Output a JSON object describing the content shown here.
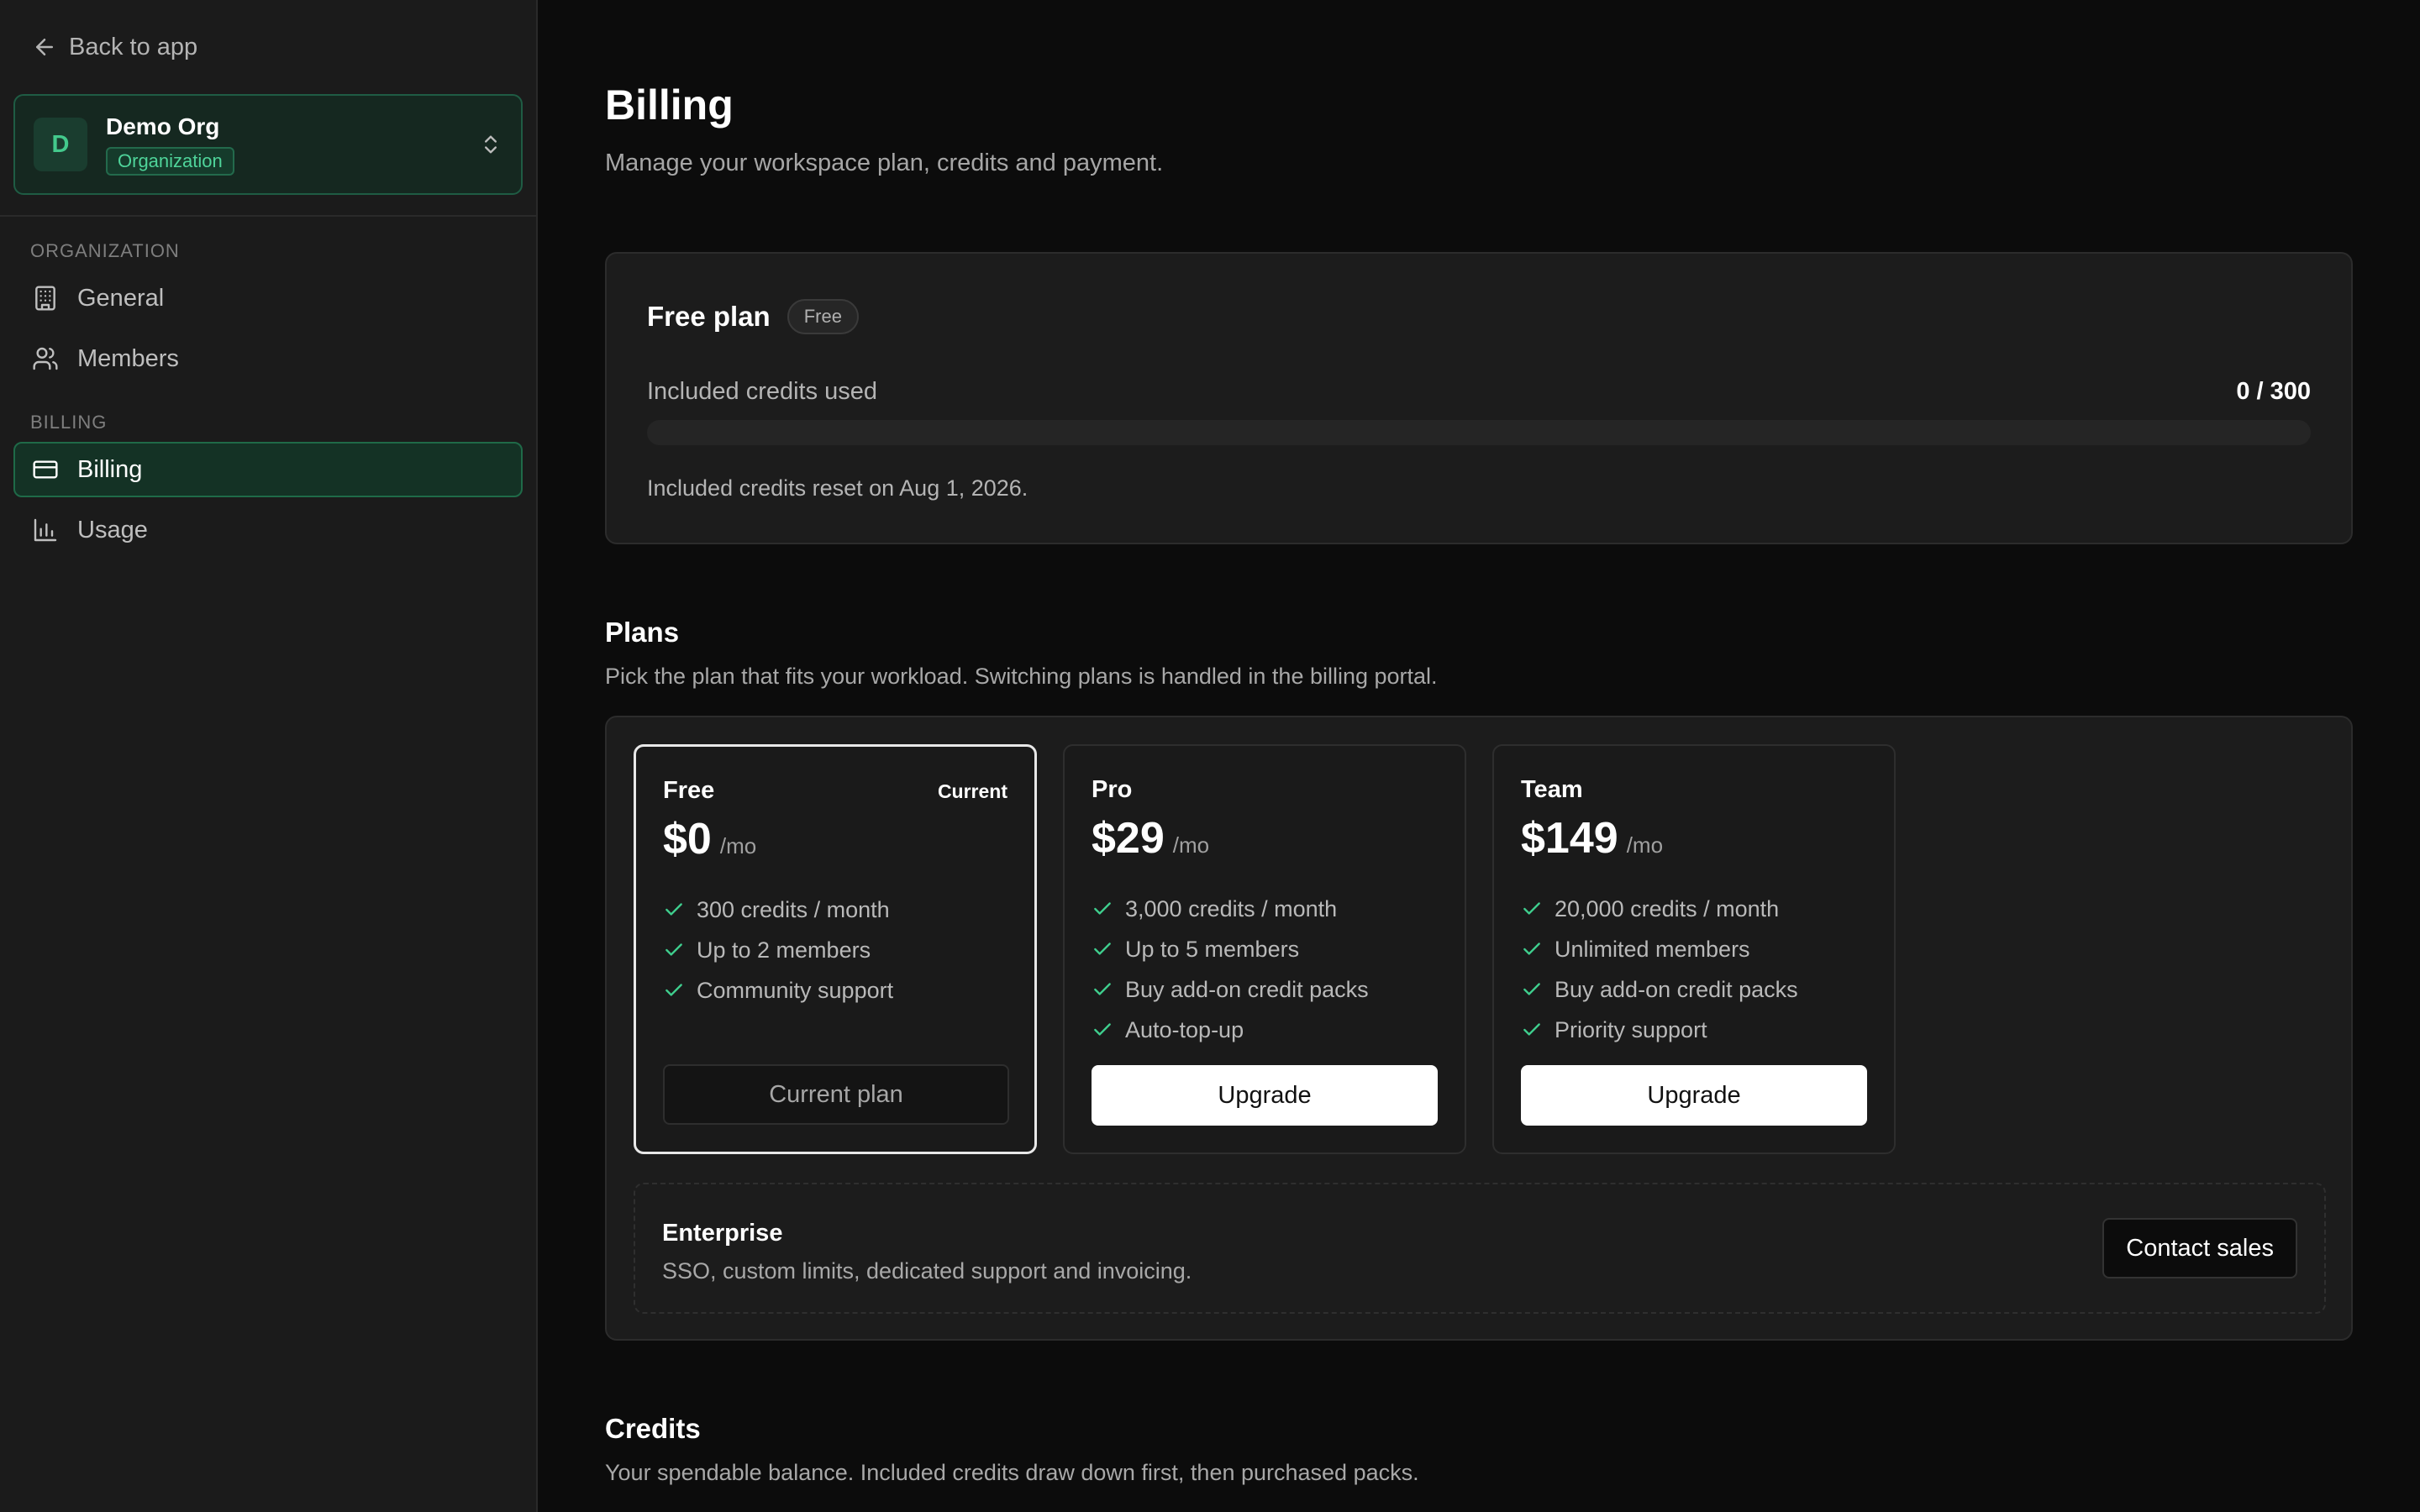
{
  "sidebar": {
    "back_label": "Back to app",
    "org": {
      "initial": "D",
      "name": "Demo Org",
      "badge": "Organization"
    },
    "sections": [
      {
        "label": "ORGANIZATION",
        "items": [
          {
            "label": "General",
            "icon": "building-icon"
          },
          {
            "label": "Members",
            "icon": "users-icon"
          }
        ]
      },
      {
        "label": "BILLING",
        "items": [
          {
            "label": "Billing",
            "icon": "credit-card-icon",
            "active": true
          },
          {
            "label": "Usage",
            "icon": "bar-chart-icon"
          }
        ]
      }
    ]
  },
  "header": {
    "title": "Billing",
    "subtitle": "Manage your workspace plan, credits and payment."
  },
  "current_plan": {
    "title": "Free plan",
    "badge": "Free",
    "usage_label": "Included credits used",
    "usage_value": "0 / 300",
    "used_fraction": 0,
    "reset_text": "Included credits reset on Aug 1, 2026."
  },
  "plans": {
    "title": "Plans",
    "subtitle": "Pick the plan that fits your workload. Switching plans is handled in the billing portal.",
    "tiers": [
      {
        "name": "Free",
        "current_label": "Current",
        "price": "$0",
        "unit": "/mo",
        "features": [
          "300 credits / month",
          "Up to 2 members",
          "Community support"
        ],
        "button": "Current plan"
      },
      {
        "name": "Pro",
        "price": "$29",
        "unit": "/mo",
        "features": [
          "3,000 credits / month",
          "Up to 5 members",
          "Buy add-on credit packs",
          "Auto-top-up"
        ],
        "button": "Upgrade"
      },
      {
        "name": "Team",
        "price": "$149",
        "unit": "/mo",
        "features": [
          "20,000 credits / month",
          "Unlimited members",
          "Buy add-on credit packs",
          "Priority support"
        ],
        "button": "Upgrade"
      }
    ],
    "enterprise": {
      "title": "Enterprise",
      "subtitle": "SSO, custom limits, dedicated support and invoicing.",
      "button": "Contact sales"
    }
  },
  "credits": {
    "title": "Credits",
    "subtitle": "Your spendable balance. Included credits draw down first, then purchased packs."
  },
  "colors": {
    "accent": "#3fcf8e",
    "background": "#0c0c0c",
    "sidebar": "#1b1b1b"
  }
}
